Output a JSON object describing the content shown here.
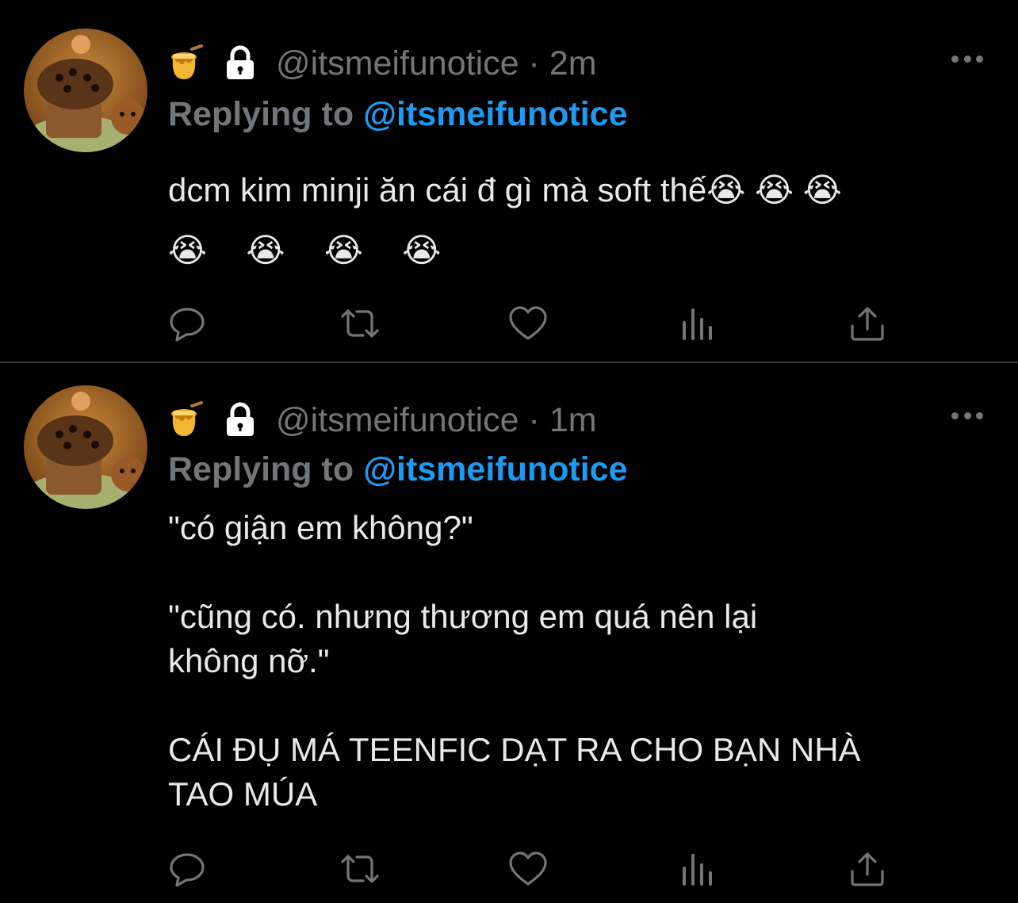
{
  "tweets": [
    {
      "handle": "@itsmeifunotice",
      "separator": "·",
      "time": "2m",
      "replying_prefix": "Replying to ",
      "replying_to": "@itsmeifunotice",
      "body_lines": [
        "dcm kim minji ăn cái đ gì mà soft thế😭 😭 😭",
        "😭 😭 😭 😭"
      ]
    },
    {
      "handle": "@itsmeifunotice",
      "separator": "·",
      "time": "1m",
      "replying_prefix": "Replying to ",
      "replying_to": "@itsmeifunotice",
      "body_lines": [
        "\"có giận em không?\"",
        "",
        "\"cũng có. nhưng thương em quá nên lại",
        "không nỡ.\"",
        "",
        "CÁI ĐỤ MÁ TEENFIC DẠT RA CHO BẠN NHÀ",
        "TAO MÚA"
      ]
    }
  ],
  "icons": {
    "name_emoji": "honey-pot-icon",
    "protected": "lock-icon",
    "more": "more-horizontal-icon",
    "reply": "reply-icon",
    "retweet": "retweet-icon",
    "like": "heart-icon",
    "views": "views-icon",
    "share": "share-icon"
  },
  "colors": {
    "background": "#000000",
    "text": "#e7e9ea",
    "secondary": "#71767b",
    "mention": "#1d9bf0",
    "divider": "#2f3336"
  }
}
